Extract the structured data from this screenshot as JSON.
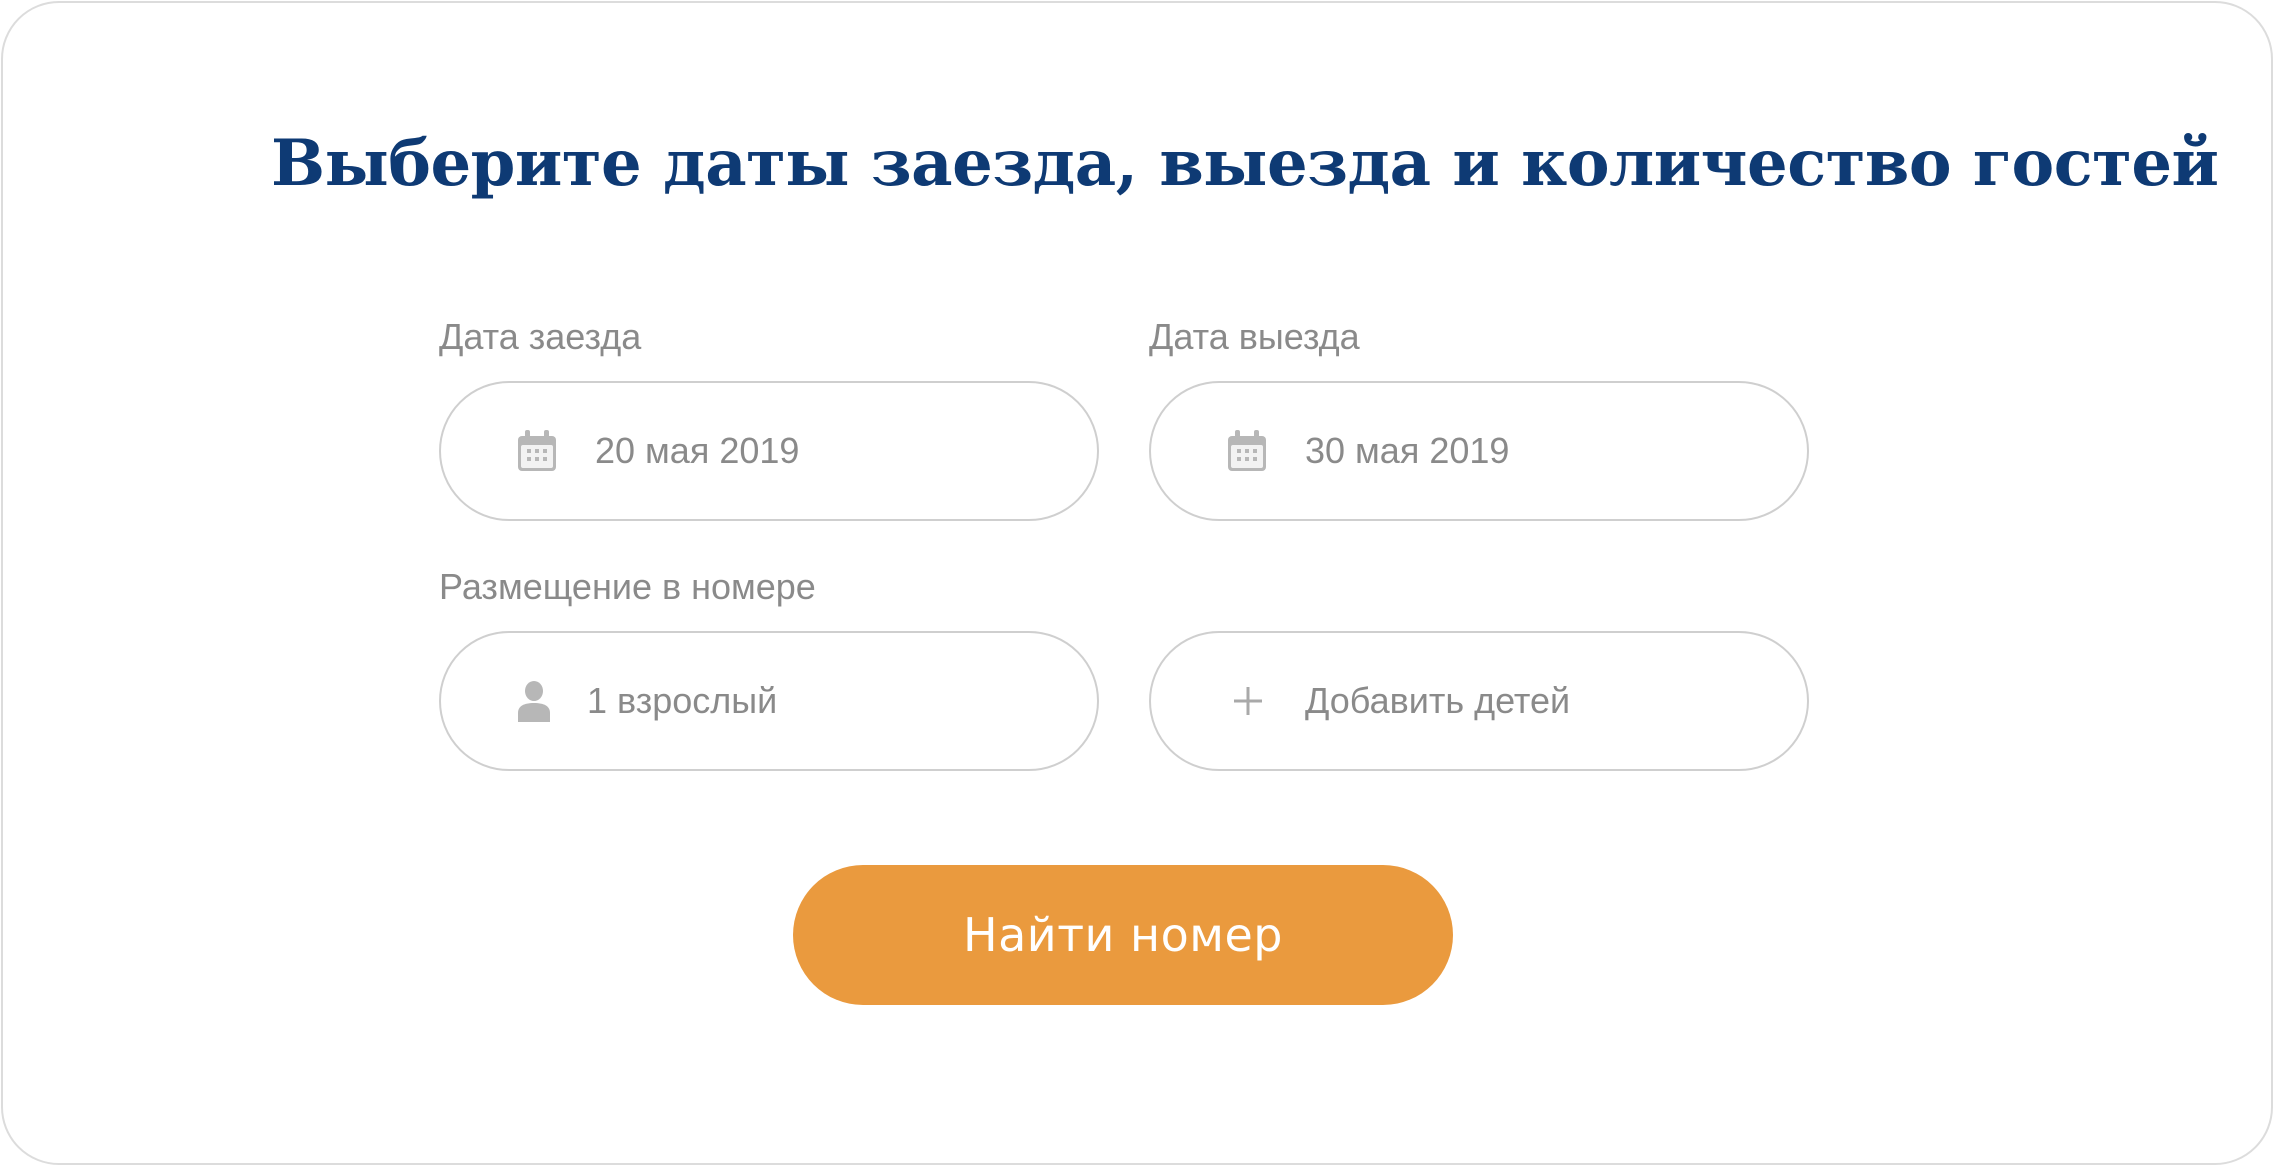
{
  "title": "Выберите даты заезда, выезда и количество гостей",
  "checkin": {
    "label": "Дата заезда",
    "value": "20 мая 2019",
    "icon": "calendar-icon"
  },
  "checkout": {
    "label": "Дата выезда",
    "value": "30 мая 2019",
    "icon": "calendar-icon"
  },
  "accommodation": {
    "label": "Размещение в номере",
    "adults": {
      "value": "1 взрослый",
      "icon": "person-icon"
    },
    "children": {
      "value": "Добавить детей",
      "icon": "plus-icon"
    }
  },
  "search_button": {
    "label": "Найти номер",
    "color": "#ea9a3e"
  },
  "colors": {
    "title": "#0e3a74",
    "muted_text": "#8a8a8a",
    "border": "#cfcfcf",
    "icon": "#b7b7b7"
  }
}
